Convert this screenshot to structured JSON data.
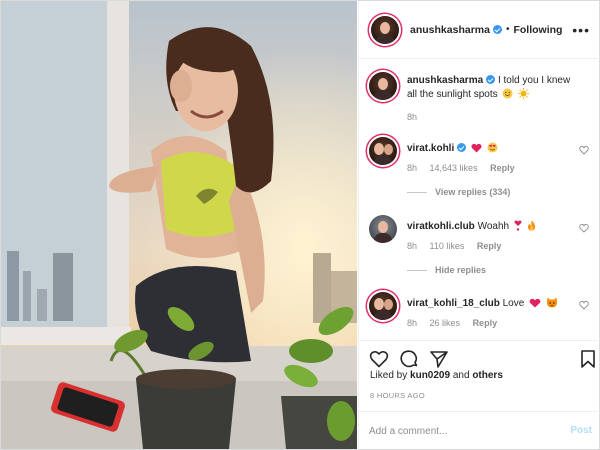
{
  "post": {
    "author": "anushkasharma",
    "follow_status": "Following",
    "caption": {
      "username": "anushkasharma",
      "text": "I told you I knew all the sunlight spots",
      "emojis": [
        "smiling-face-emoji",
        "sun-emoji"
      ],
      "time": "8h"
    }
  },
  "comments": [
    {
      "username": "virat.kohli",
      "text": "",
      "emojis": [
        "red-heart-emoji",
        "heart-eyes-emoji"
      ],
      "time": "8h",
      "likes": "14,643 likes",
      "reply_label": "Reply",
      "view_replies": "View replies (334)"
    },
    {
      "username": "viratkohli.club",
      "text": "Woahh",
      "emojis": [
        "heart-exclamation-emoji",
        "fire-emoji"
      ],
      "time": "8h",
      "likes": "110 likes",
      "reply_label": "Reply",
      "hide_replies": "Hide replies"
    },
    {
      "username": "virat_kohli_18_club",
      "text": "Love",
      "emojis": [
        "heart-emoji",
        "cat-emoji"
      ],
      "time": "8h",
      "likes": "26 likes",
      "reply_label": "Reply"
    }
  ],
  "actions": {
    "icons": [
      "heart-icon",
      "comment-icon",
      "share-icon",
      "bookmark-icon"
    ]
  },
  "likes_summary": {
    "prefix": "Liked by",
    "user": "kun0209",
    "middle": "and",
    "others": "others"
  },
  "timestamp": "8 HOURS AGO",
  "add_comment": {
    "placeholder": "Add a comment...",
    "post_label": "Post"
  },
  "colors": {
    "verified": "#3897f0",
    "post_disabled": "#b2dffc",
    "muted": "#8e8e8e",
    "text": "#262626"
  }
}
